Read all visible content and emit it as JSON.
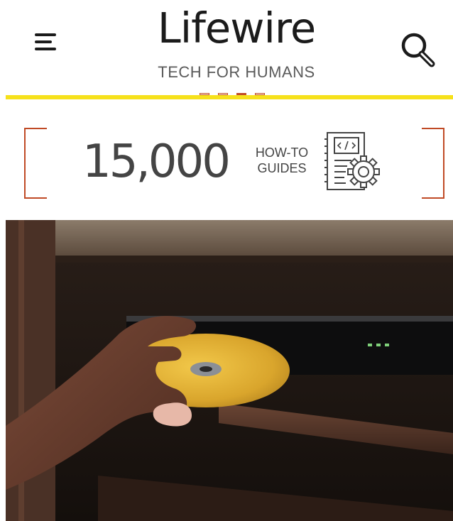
{
  "header": {
    "logo": "Lifewire",
    "tagline": "TECH FOR HUMANS",
    "menu_icon": "hamburger-menu-icon",
    "search_icon": "search-icon",
    "accent_rule_color": "#f6e11b"
  },
  "promo": {
    "count": "15,000",
    "label_line1": "HOW-TO",
    "label_line2": "GUIDES",
    "icon": "code-document-gear-icon",
    "accent_color": "#c04a25",
    "carousel": {
      "total_slides": 4,
      "active_slide": 3
    }
  },
  "hero": {
    "subject": "hand inserting a yellow disc into a disc player",
    "icon": "hero-photo"
  }
}
